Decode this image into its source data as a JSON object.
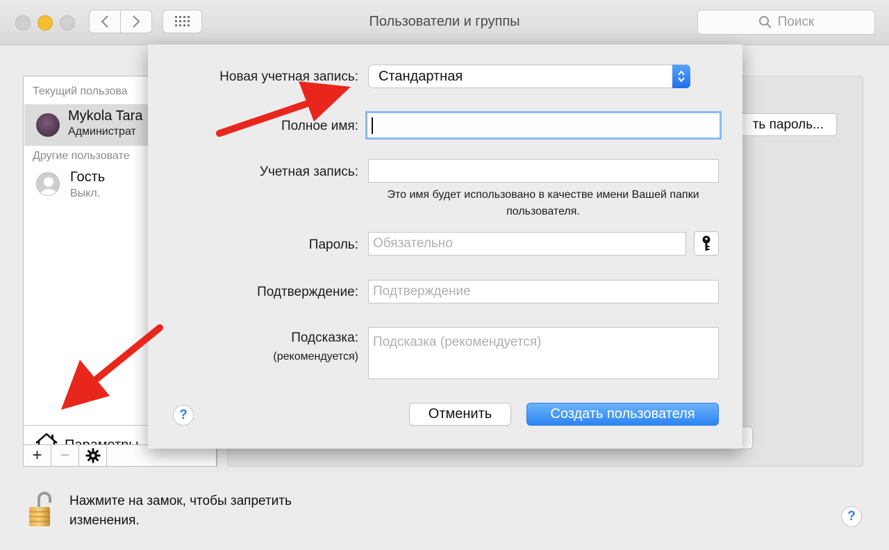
{
  "window": {
    "title": "Пользователи и группы",
    "search_placeholder": "Поиск"
  },
  "sidebar": {
    "current_section": "Текущий пользова",
    "current_user_name": "Mykola Tara",
    "current_user_role": "Администрат",
    "other_section": "Другие пользовате",
    "guest_name": "Гость",
    "guest_status": "Выкл.",
    "params_label": "Параметры",
    "add_label": "+",
    "remove_label": "−"
  },
  "background": {
    "change_password_label": "ть пароль...",
    "lock_text": "Нажмите на замок, чтобы запретить изменения.",
    "help_label": "?"
  },
  "sheet": {
    "account_type_label": "Новая учетная запись:",
    "account_type_value": "Стандартная",
    "full_name_label": "Полное имя:",
    "full_name_value": "",
    "account_name_label": "Учетная запись:",
    "account_name_value": "",
    "account_note": "Это имя будет использовано в качестве имени Вашей папки пользователя.",
    "password_label": "Пароль:",
    "password_placeholder": "Обязательно",
    "verify_label": "Подтверждение:",
    "verify_placeholder": "Подтверждение",
    "hint_label": "Подсказка:",
    "hint_label_sub": "(рекомендуется)",
    "hint_placeholder": "Подсказка (рекомендуется)",
    "help_label": "?",
    "cancel_label": "Отменить",
    "create_label": "Создать пользователя"
  },
  "colors": {
    "accent": "#2b84f3",
    "focus_ring": "#8bb8f0",
    "annotation_arrow": "#e8261c"
  }
}
